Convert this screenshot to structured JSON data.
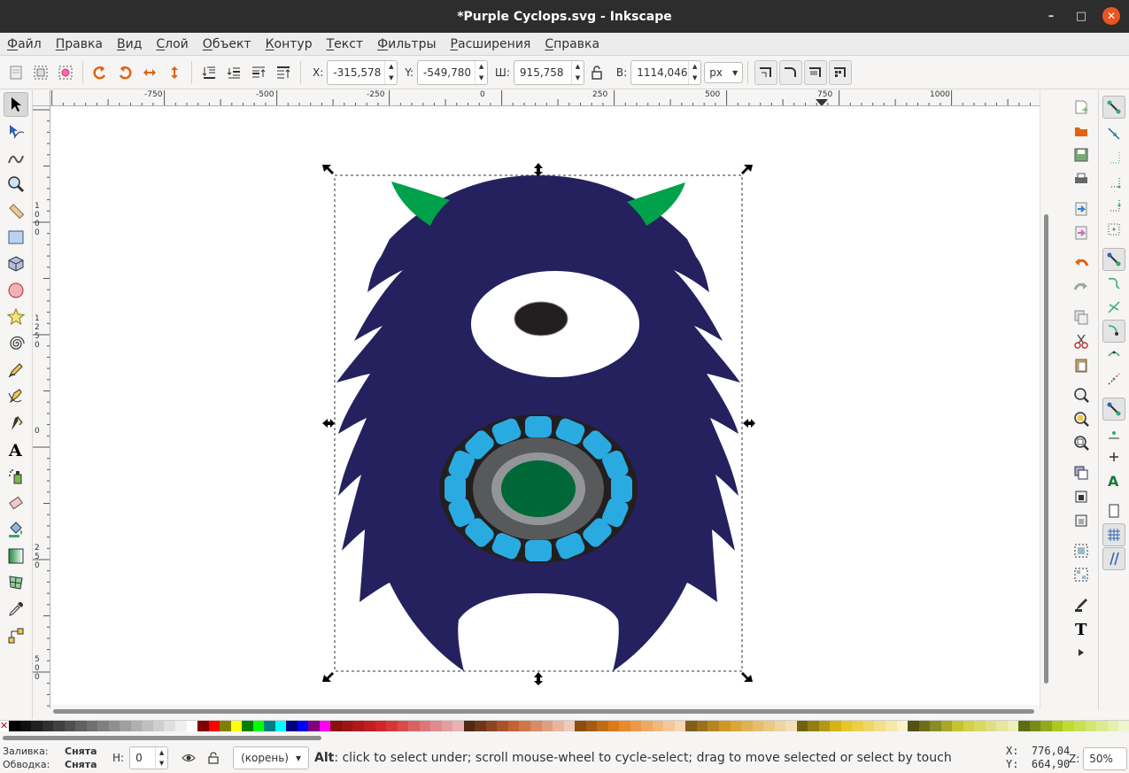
{
  "window": {
    "title": "*Purple Cyclops.svg - Inkscape",
    "minimize_glyph": "–",
    "maximize_glyph": "□",
    "close_glyph": "✕"
  },
  "menu": [
    "Файл",
    "Правка",
    "Вид",
    "Слой",
    "Объект",
    "Контур",
    "Текст",
    "Фильтры",
    "Расширения",
    "Справка"
  ],
  "toolbar": {
    "x_label": "X:",
    "x_value": "-315,578",
    "y_label": "Y:",
    "y_value": "-549,780",
    "w_label": "Ш:",
    "w_value": "915,758",
    "h_label": "В:",
    "h_value": "1114,046",
    "unit": "px"
  },
  "hruler_ticks": [
    "-750",
    "-500",
    "-250",
    "0",
    "250",
    "500",
    "750",
    "1000"
  ],
  "vruler_ticks": [
    "1000",
    "1250",
    "0",
    "250",
    "500"
  ],
  "status": {
    "fill_label": "Заливка:",
    "fill_value": "Снята",
    "stroke_label": "Обводка:",
    "stroke_value": "Снята",
    "opacity_label": "Н:",
    "opacity_value": "0",
    "layer": "(корень)",
    "message_key": "Alt",
    "message": ": click to select under; scroll mouse-wheel to cycle-select; drag to move selected or select by touch",
    "cursor_x": "X:  776,04",
    "cursor_y": "Y:  664,90",
    "zoom_label": "Z:",
    "zoom_value": "50%"
  },
  "colors": {
    "monster_body": "#25215f",
    "horns": "#00a14b",
    "eye_white": "#ffffff",
    "pupil": "#231f20",
    "mouth_outer": "#231f20",
    "teeth": "#29abe2",
    "mouth_ring": "#58595b",
    "mouth_inner_ring": "#939598",
    "mouth_center": "#006837"
  }
}
